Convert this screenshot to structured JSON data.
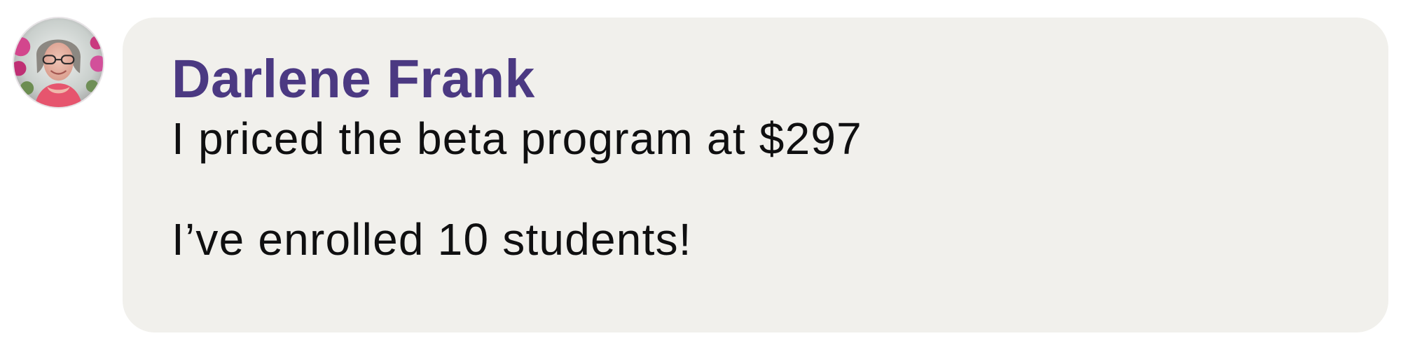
{
  "message": {
    "sender_name": "Darlene Frank",
    "lines": [
      "I priced the beta program at $297",
      "I’ve enrolled 10 students!"
    ]
  },
  "avatar": {
    "icon": "user-avatar-photo"
  },
  "colors": {
    "sender_name": "#4b3982",
    "bubble_background": "#f1f0ec",
    "message_text": "#0f0f10"
  }
}
